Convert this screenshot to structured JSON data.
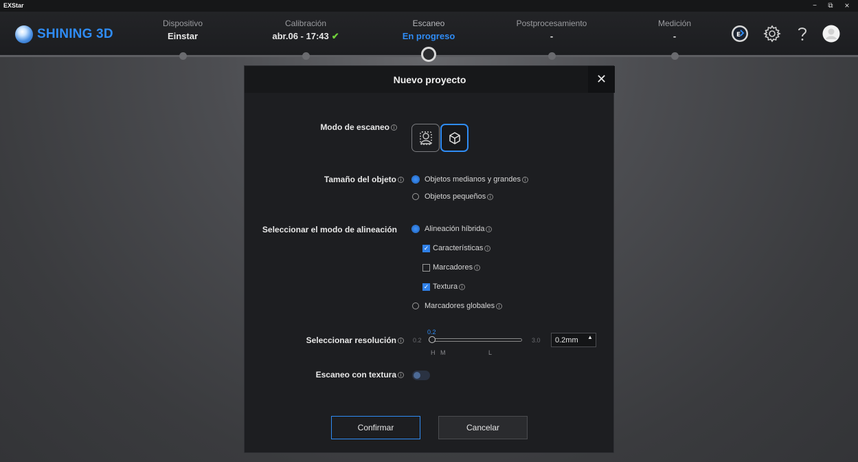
{
  "window": {
    "title": "EXStar",
    "minimize": "−",
    "restore": "⧉",
    "close": "×"
  },
  "brand": {
    "name": "SHINING 3D"
  },
  "steps": [
    {
      "label": "Dispositivo",
      "value": "Einstar"
    },
    {
      "label": "Calibración",
      "value": "abr.06 - 17:43"
    },
    {
      "label": "Escaneo",
      "value": "En progreso"
    },
    {
      "label": "Postprocesamiento",
      "value": "-"
    },
    {
      "label": "Medición",
      "value": "-"
    }
  ],
  "top_icons": [
    "ex-models-icon",
    "settings-gear-icon",
    "help-question-icon",
    "user-avatar-icon"
  ],
  "dialog": {
    "title": "Nuevo proyecto",
    "close": "✕",
    "scan_mode": {
      "label": "Modo de escaneo",
      "options": [
        "portrait-mode-icon",
        "object-cube-icon"
      ],
      "selected": "object-cube-icon"
    },
    "object_size": {
      "label": "Tamaño del objeto",
      "options": [
        "Objetos medianos y grandes",
        "Objetos pequeños"
      ],
      "selected": "Objetos medianos y grandes"
    },
    "alignment": {
      "label": "Seleccionar el modo de alineación",
      "hybrid": "Alineación híbrida",
      "features": "Características",
      "markers": "Marcadores",
      "texture": "Textura",
      "global_markers": "Marcadores globales",
      "features_checked": true,
      "markers_checked": false,
      "texture_checked": true
    },
    "resolution": {
      "label": "Seleccionar resolución",
      "current": "0.2",
      "min": "0.2",
      "max": "3.0",
      "input_value": "0.2mm",
      "ticks": [
        "H",
        "M",
        "L"
      ]
    },
    "texture_scan": {
      "label": "Escaneo con textura",
      "enabled": false
    },
    "confirm": "Confirmar",
    "cancel": "Cancelar"
  },
  "colors": {
    "accent": "#2f8cf5",
    "check": "#6fcf3a"
  }
}
